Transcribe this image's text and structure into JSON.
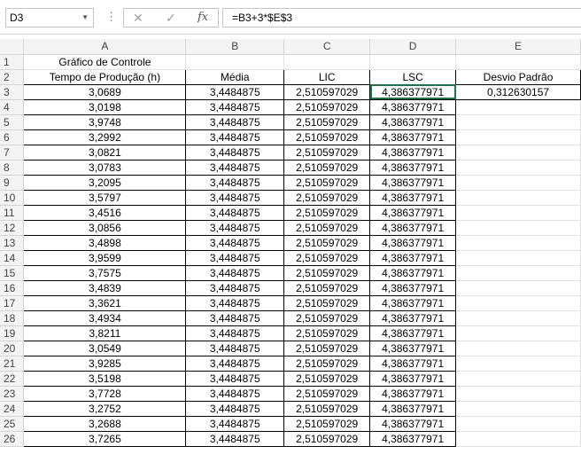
{
  "formula_bar": {
    "name_box": "D3",
    "cancel_glyph": "✕",
    "enter_glyph": "✓",
    "fx_label": "fx",
    "formula": "=B3+3*$E$3"
  },
  "columns": [
    "A",
    "B",
    "C",
    "D",
    "E"
  ],
  "title": "Gráfico de Controle",
  "headers": [
    "Tempo de Produção (h)",
    "Média",
    "LIC",
    "LSC",
    "Desvio Padrão"
  ],
  "desvio_padrao": "0,312630157",
  "media": "3,4484875",
  "lic": "2,510597029",
  "lsc": "4,386377971",
  "rows": [
    {
      "n": "3",
      "a": "3,0689"
    },
    {
      "n": "4",
      "a": "3,0198"
    },
    {
      "n": "5",
      "a": "3,9748"
    },
    {
      "n": "6",
      "a": "3,2992"
    },
    {
      "n": "7",
      "a": "3,0821"
    },
    {
      "n": "8",
      "a": "3,0783"
    },
    {
      "n": "9",
      "a": "3,2095"
    },
    {
      "n": "10",
      "a": "3,5797"
    },
    {
      "n": "11",
      "a": "3,4516"
    },
    {
      "n": "12",
      "a": "3,0856"
    },
    {
      "n": "13",
      "a": "3,4898"
    },
    {
      "n": "14",
      "a": "3,9599"
    },
    {
      "n": "15",
      "a": "3,7575"
    },
    {
      "n": "16",
      "a": "3,4839"
    },
    {
      "n": "17",
      "a": "3,3621"
    },
    {
      "n": "18",
      "a": "3,4934"
    },
    {
      "n": "19",
      "a": "3,8211"
    },
    {
      "n": "20",
      "a": "3,0549"
    },
    {
      "n": "21",
      "a": "3,9285"
    },
    {
      "n": "22",
      "a": "3,5198"
    },
    {
      "n": "23",
      "a": "3,7728"
    },
    {
      "n": "24",
      "a": "3,2752"
    },
    {
      "n": "25",
      "a": "3,2688"
    },
    {
      "n": "26",
      "a": "3,7265"
    }
  ]
}
